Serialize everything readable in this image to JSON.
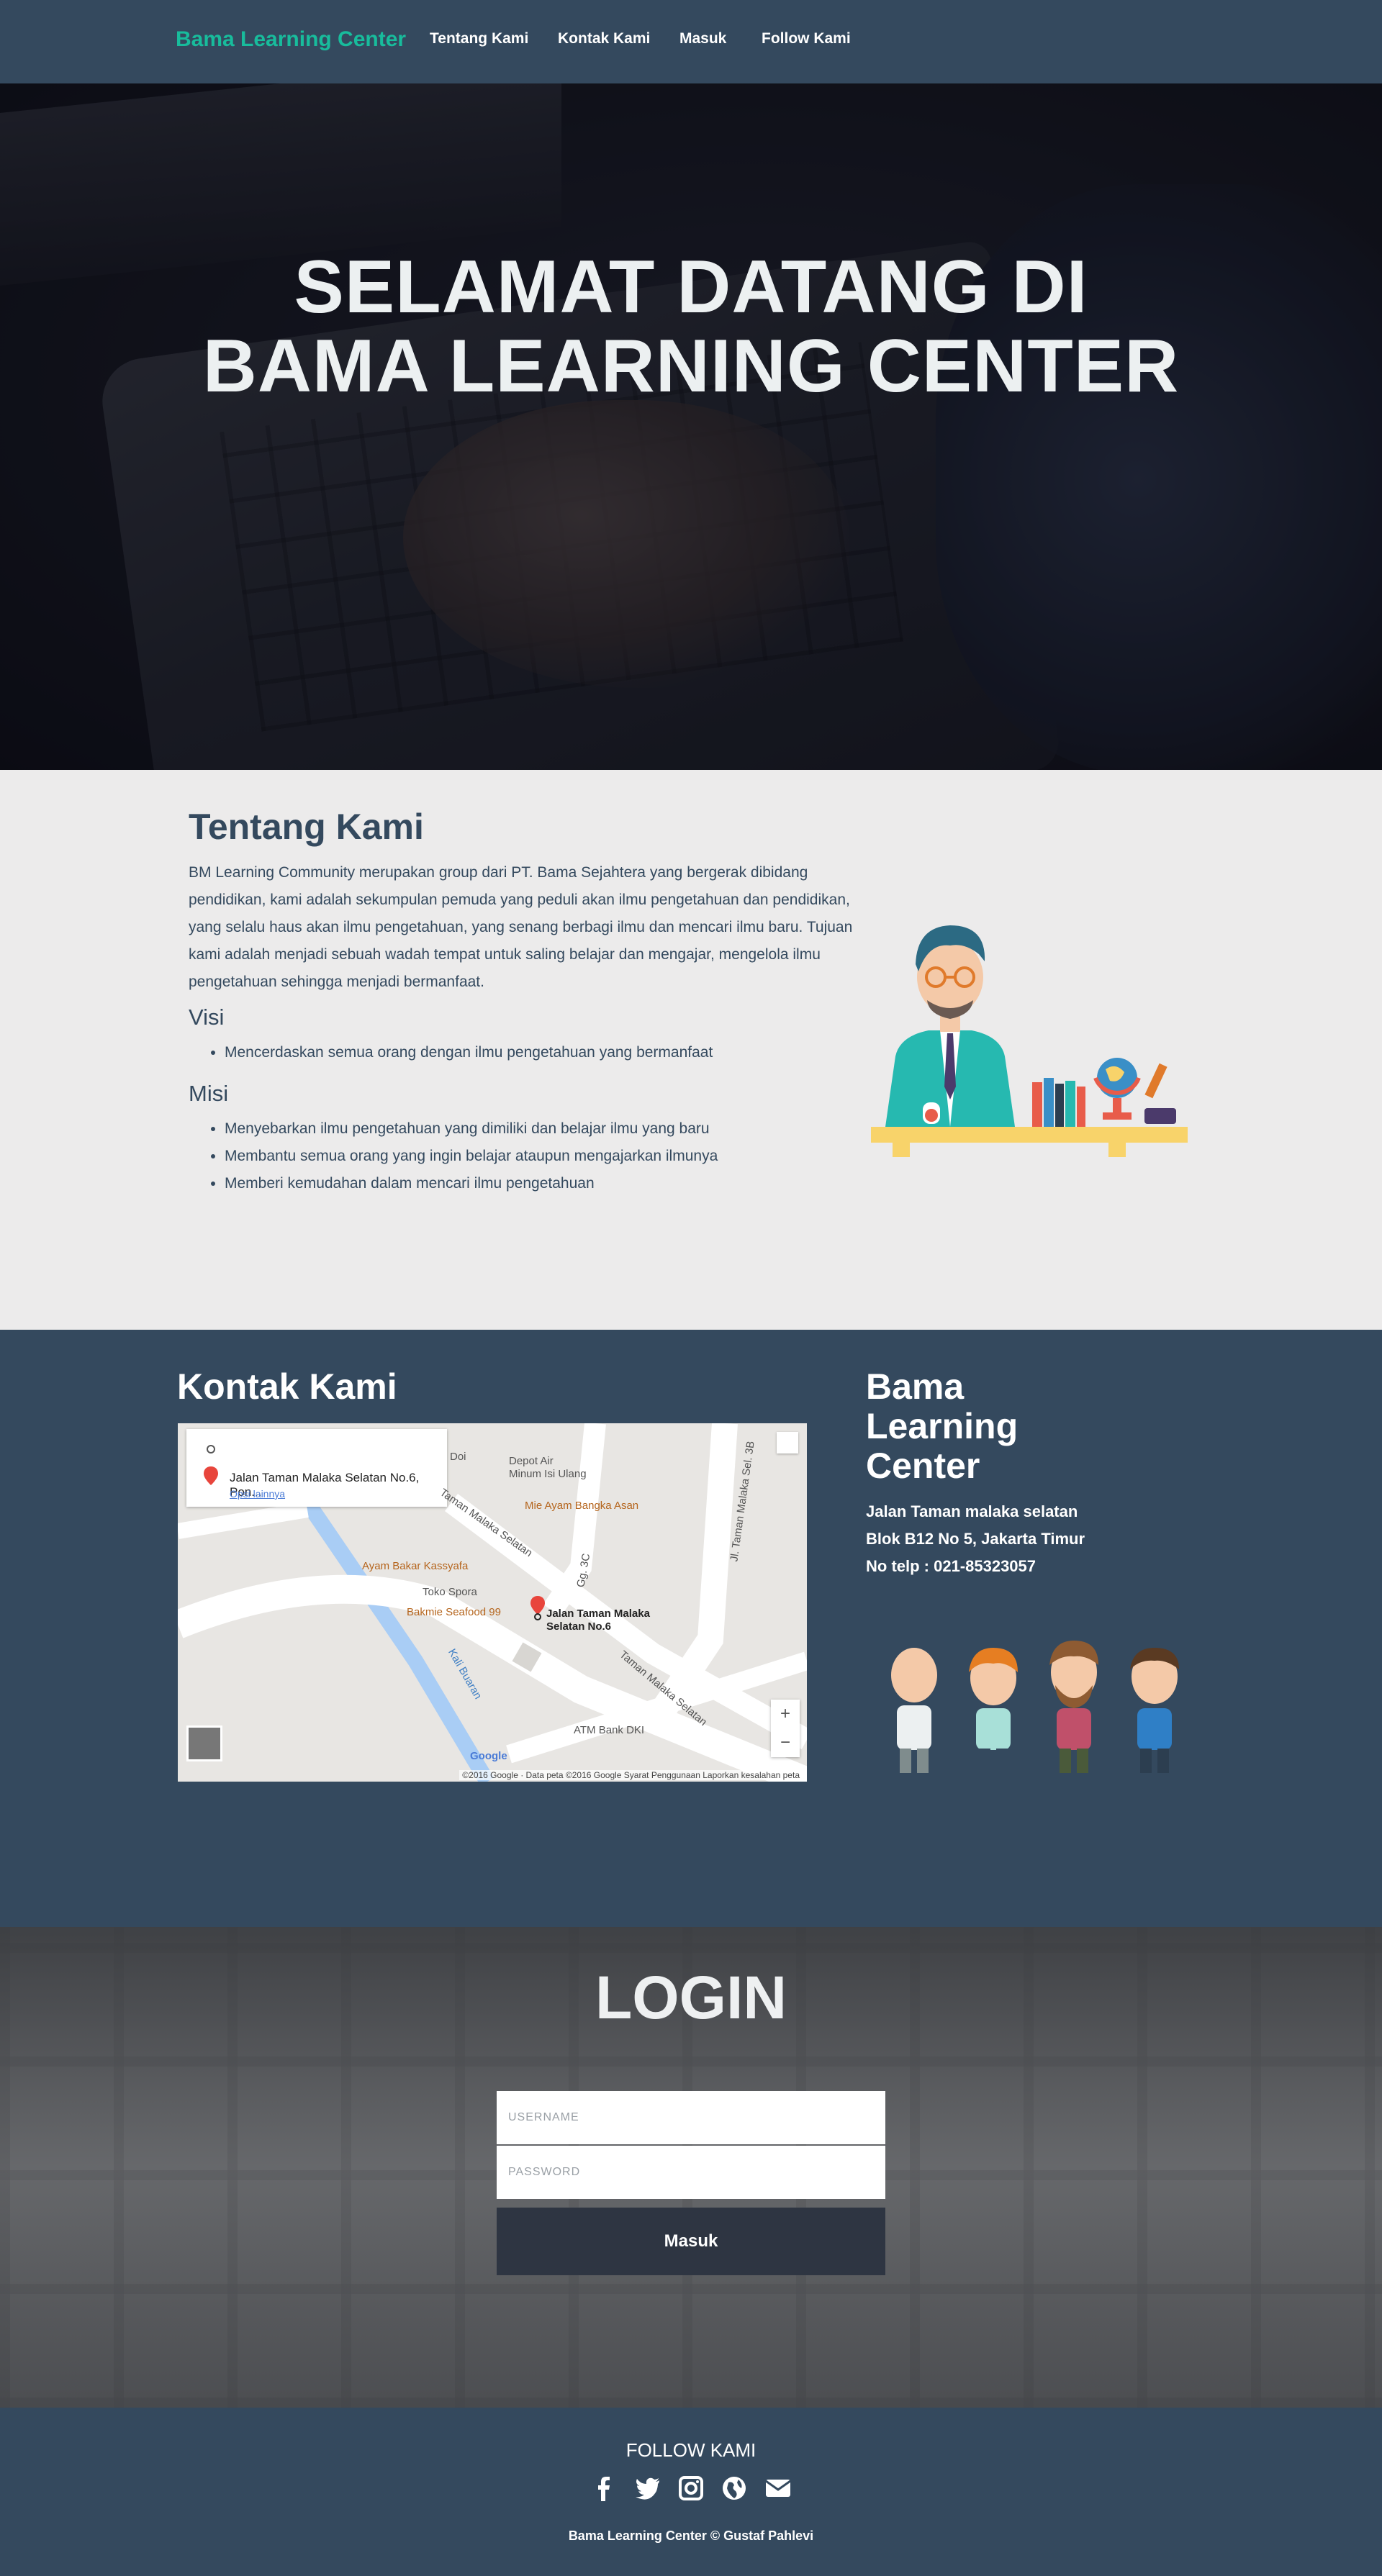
{
  "navbar": {
    "brand": "Bama Learning Center",
    "links": [
      "Tentang Kami",
      "Kontak Kami",
      "Masuk",
      "Follow Kami"
    ]
  },
  "hero": {
    "line1": "SELAMAT DATANG DI",
    "line2": "BAMA LEARNING CENTER"
  },
  "about": {
    "title": "Tentang Kami",
    "description": "BM Learning Community merupakan group dari PT. Bama Sejahtera yang bergerak dibidang pendidikan, kami adalah sekumpulan pemuda yang peduli akan ilmu pengetahuan dan pendidikan, yang selalu haus akan ilmu pengetahuan, yang senang berbagi ilmu dan mencari ilmu baru. Tujuan kami adalah menjadi sebuah wadah tempat untuk saling belajar dan mengajar, mengelola ilmu pengetahuan sehingga menjadi bermanfaat.",
    "visi_title": "Visi",
    "visi": [
      "Mencerdaskan semua orang dengan ilmu pengetahuan yang bermanfaat"
    ],
    "misi_title": "Misi",
    "misi": [
      "Menyebarkan ilmu pengetahuan yang dimiliki dan belajar ilmu yang baru",
      "Membantu semua orang yang ingin belajar ataupun mengajarkan ilmunya",
      "Memberi kemudahan dalam mencari ilmu pengetahuan"
    ]
  },
  "contact": {
    "title": "Kontak Kami",
    "map": {
      "card_address": "Jalan Taman Malaka Selatan No.6, Pon...",
      "card_link": "Opsi lainnya",
      "pin_label_1": "Jalan Taman Malaka",
      "pin_label_2": "Selatan No.6",
      "labels": [
        "Depot Air",
        "Minum Isi Ulang",
        "Toko Spora",
        "ATM Bank DKI",
        "Jl. Taman Malaka Sel. 3B",
        "Jl. Taman Malaka Selatan",
        "Taman Malaka Selatan",
        "Kali Buaran",
        "Gg. 3C",
        "Doi"
      ],
      "pois": [
        "Mie Ayam Bangka Asan",
        "Ayam Bakar Kassyafa",
        "Bakmie Seafood 99"
      ],
      "zoom_in": "+",
      "zoom_out": "−",
      "attribution": "©2016 Google · Data peta ©2016 Google    Syarat Penggunaan    Laporkan kesalahan peta",
      "google": "Google"
    },
    "org_name": "Bama Learning Center",
    "address_1": "Jalan Taman malaka selatan",
    "address_2": "Blok B12 No 5, Jakarta Timur",
    "phone": "No telp : 021-85323057"
  },
  "login": {
    "title": "LOGIN",
    "username_placeholder": "USERNAME",
    "password_placeholder": "PASSWORD",
    "button": "Masuk"
  },
  "footer": {
    "title": "FOLLOW KAMI",
    "icons": [
      "facebook-icon",
      "twitter-icon",
      "instagram-icon",
      "globe-icon",
      "envelope-icon"
    ],
    "copyright": "Bama Learning Center © Gustaf Pahlevi"
  },
  "colors": {
    "navbar": "#34495e",
    "brand": "#18bc9c",
    "about_bg": "#ecebeb",
    "login_button": "#2e3542"
  }
}
